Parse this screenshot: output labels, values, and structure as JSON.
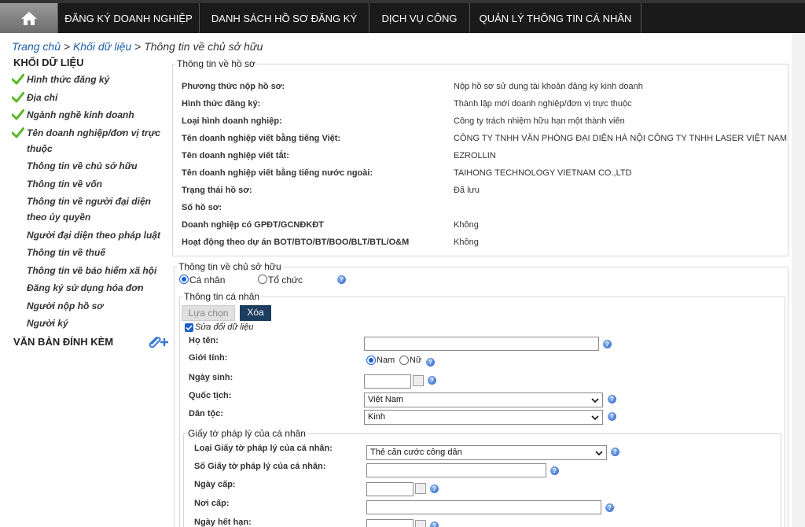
{
  "nav": {
    "home_icon": "home-icon",
    "items": [
      {
        "label": "ĐĂNG KÝ DOANH NGHIỆP"
      },
      {
        "label": "DANH SÁCH HỒ SƠ ĐĂNG KÝ"
      },
      {
        "label": "DỊCH VỤ CÔNG"
      },
      {
        "label": "QUẢN LÝ THÔNG TIN CÁ NHÂN"
      }
    ]
  },
  "breadcrumb": {
    "home": "Trang chủ",
    "sep1": ">",
    "section": "Khối dữ liệu",
    "sep2": ">",
    "current": "Thông tin về chủ sở hữu"
  },
  "sidebar": {
    "title": "KHỐI DỮ LIỆU",
    "items": [
      {
        "label": "Hình thức đăng ký",
        "done": true
      },
      {
        "label": "Địa chỉ",
        "done": true
      },
      {
        "label": "Ngành nghề kinh doanh",
        "done": true
      },
      {
        "label": "Tên doanh nghiệp/đơn vị trực thuộc",
        "done": true
      },
      {
        "label": "Thông tin về chủ sở hữu",
        "done": false
      },
      {
        "label": "Thông tin về vốn",
        "done": false
      },
      {
        "label": "Thông tin về người đại diện theo ủy quyền",
        "done": false
      },
      {
        "label": "Người đại diện theo pháp luật",
        "done": false
      },
      {
        "label": "Thông tin về thuế",
        "done": false
      },
      {
        "label": "Thông tin về bảo hiểm xã hội",
        "done": false
      },
      {
        "label": "Đăng ký sử dụng hóa đơn",
        "done": false
      },
      {
        "label": "Người nộp hồ sơ",
        "done": false
      },
      {
        "label": "Người ký",
        "done": false
      }
    ],
    "attachments_title": "VĂN BẢN ĐÍNH KÈM"
  },
  "profile": {
    "legend": "Thông tin về hồ sơ",
    "rows": [
      {
        "label": "Phương thức nộp hồ sơ:",
        "value": "Nộp hồ sơ sử dụng tài khoản đăng ký kinh doanh"
      },
      {
        "label": "Hình thức đăng ký:",
        "value": "Thành lập mới doanh nghiệp/đơn vị trực thuộc"
      },
      {
        "label": "Loại hình doanh nghiệp:",
        "value": "Công ty trách nhiệm hữu hạn một thành viên"
      },
      {
        "label": "Tên doanh nghiệp viết bằng tiếng Việt:",
        "value": "CÔNG TY TNHH VĂN PHÒNG ĐẠI DIỆN HÀ NỘI CÔNG TY TNHH LASER VIỆT NAM"
      },
      {
        "label": "Tên doanh nghiệp viết tắt:",
        "value": "EZROLLIN"
      },
      {
        "label": "Tên doanh nghiệp viết bằng tiếng nước ngoài:",
        "value": "TAIHONG TECHNOLOGY VIETNAM CO.,LTD"
      },
      {
        "label": "Trạng thái hồ sơ:",
        "value": "Đã lưu"
      },
      {
        "label": "Số hồ sơ:",
        "value": ""
      },
      {
        "label": "Doanh nghiệp có GPĐT/GCNĐKĐT",
        "value": "Không"
      },
      {
        "label": "Hoạt động theo dự án BOT/BTO/BT/BOO/BLT/BTL/O&M",
        "value": "Không"
      }
    ]
  },
  "owner": {
    "legend": "Thông tin về chủ sở hữu",
    "radio_individual": "Cá nhân",
    "radio_org": "Tổ chức",
    "personal": {
      "legend": "Thông tin cá nhân",
      "select_btn": "Lựa chọn",
      "delete_btn": "Xóa",
      "edit_checkbox": "Sửa đổi dữ liệu",
      "name_label": "Họ tên:",
      "gender_label": "Giới tính:",
      "male": "Nam",
      "female": "Nữ",
      "dob_label": "Ngày sinh:",
      "nationality_label": "Quốc tịch:",
      "nationality_value": "Việt Nam",
      "ethnicity_label": "Dân tộc:",
      "ethnicity_value": "Kinh"
    },
    "legal": {
      "legend": "Giấy tờ pháp lý của cá nhân",
      "type_label": "Loại Giấy tờ pháp lý của cá nhân:",
      "type_value": "Thẻ căn cước công dân",
      "number_label": "Số Giấy tờ pháp lý của cá nhân:",
      "issue_date_label": "Ngày cấp:",
      "issue_place_label": "Nơi cấp:",
      "expiry_label": "Ngày hết hạn:"
    }
  }
}
